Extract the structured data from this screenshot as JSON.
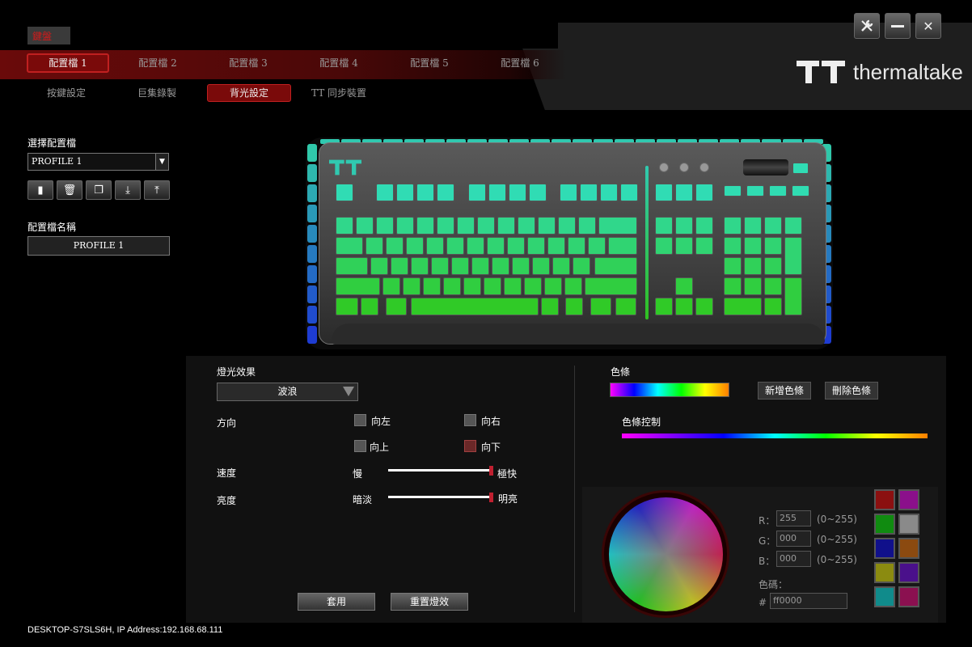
{
  "header": {
    "tag": "鍵盤",
    "brand": "thermaltake",
    "profile_tabs": [
      "配置檔 1",
      "配置檔 2",
      "配置檔 3",
      "配置檔 4",
      "配置檔 5",
      "配置檔 6"
    ],
    "sub_tabs": [
      "按鍵設定",
      "巨集錄製",
      "背光設定",
      "TT 同步裝置"
    ],
    "window_icons": [
      "settings-wrench-icon",
      "minimize-icon",
      "close-icon"
    ]
  },
  "left": {
    "select_label": "選擇配置檔",
    "selected_profile": "PROFILE 1",
    "name_label": "配置檔名稱",
    "profile_name": "PROFILE 1",
    "icons": [
      "new-profile-icon",
      "delete-icon",
      "copy-icon",
      "import-icon",
      "export-icon"
    ]
  },
  "lighting": {
    "effect_label": "燈光效果",
    "effect_value": "波浪",
    "direction_label": "方向",
    "directions": [
      {
        "label": "向左",
        "checked": false
      },
      {
        "label": "向右",
        "checked": false
      },
      {
        "label": "向上",
        "checked": false
      },
      {
        "label": "向下",
        "checked": true
      }
    ],
    "speed_label": "速度",
    "speed_min": "慢",
    "speed_max": "極快",
    "speed_value": 1.0,
    "brightness_label": "亮度",
    "brightness_min": "暗淡",
    "brightness_max": "明亮",
    "brightness_value": 1.0,
    "apply_button": "套用",
    "reset_button": "重置燈效"
  },
  "color": {
    "bar_label": "色條",
    "add_bar_button": "新增色條",
    "delete_bar_button": "刪除色條",
    "bar_control_label": "色條控制",
    "r_label": "R：",
    "g_label": "G：",
    "b_label": "B：",
    "r_value": "255",
    "g_value": "000",
    "b_value": "000",
    "range_hint": "(0~255)",
    "hex_label": "色碼：",
    "hex_prefix": "#",
    "hex_value": "ff0000",
    "swatches": [
      "#8b1010",
      "#8b108b",
      "#108b10",
      "#8a8a8a",
      "#10108b",
      "#8b4a10",
      "#8b8b10",
      "#4a108b",
      "#108b8b",
      "#8b1050"
    ]
  },
  "footer": {
    "status": "DESKTOP-S7SLS6H, IP Address:192.168.68.111"
  }
}
